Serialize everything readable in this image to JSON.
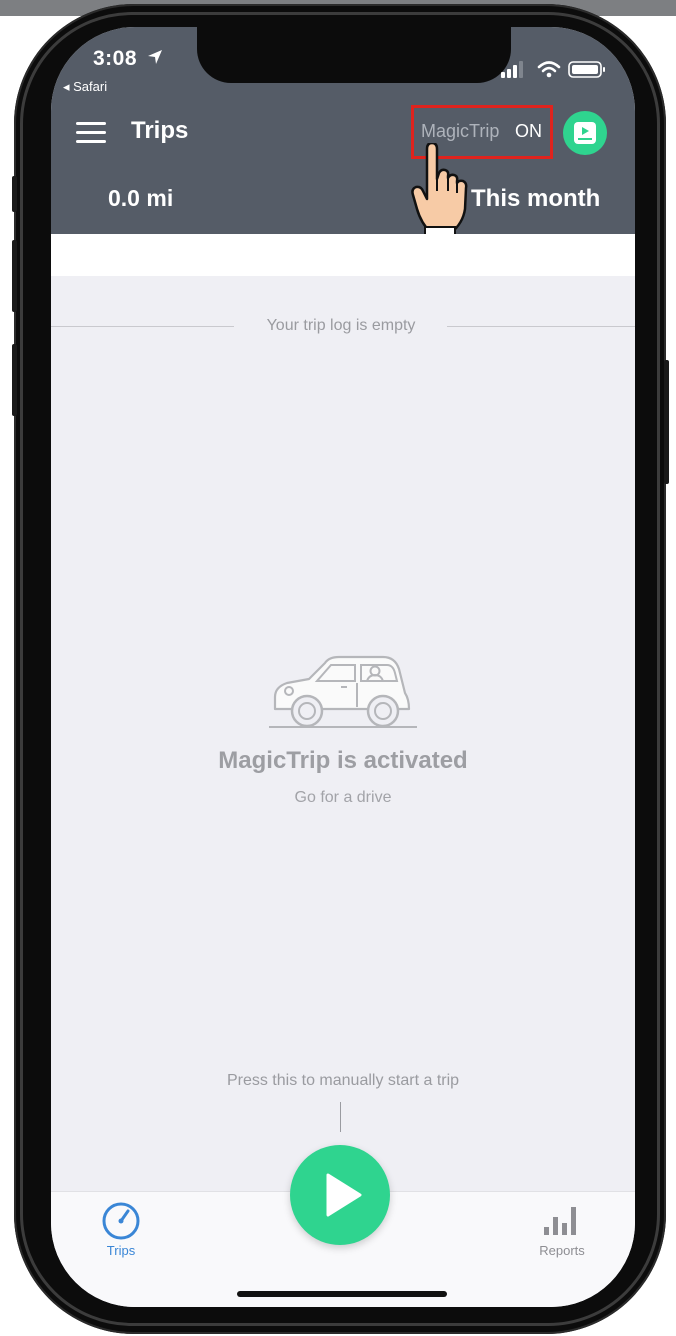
{
  "status_bar": {
    "time": "3:08",
    "back_app": "◂ Safari"
  },
  "header": {
    "title": "Trips",
    "magictrip_label": "MagicTrip",
    "magictrip_state": "ON",
    "distance": "0.0 mi",
    "period": "This month"
  },
  "content": {
    "empty_log": "Your trip log is empty",
    "activated_title": "MagicTrip is activated",
    "activated_subtitle": "Go for a drive",
    "manual_start_hint": "Press this to manually start a trip"
  },
  "tabbar": {
    "trips_label": "Trips",
    "reports_label": "Reports"
  },
  "colors": {
    "header_bg": "#555c67",
    "accent_green": "#2fd48f",
    "highlight_red": "#e0231d",
    "tab_active_blue": "#3a86d6"
  },
  "icons": [
    "location-arrow-icon",
    "signal-icon",
    "wifi-icon",
    "battery-icon",
    "menu-icon",
    "video-guide-icon",
    "pointing-hand-icon",
    "car-icon",
    "speedometer-icon",
    "bar-chart-icon",
    "play-icon"
  ]
}
